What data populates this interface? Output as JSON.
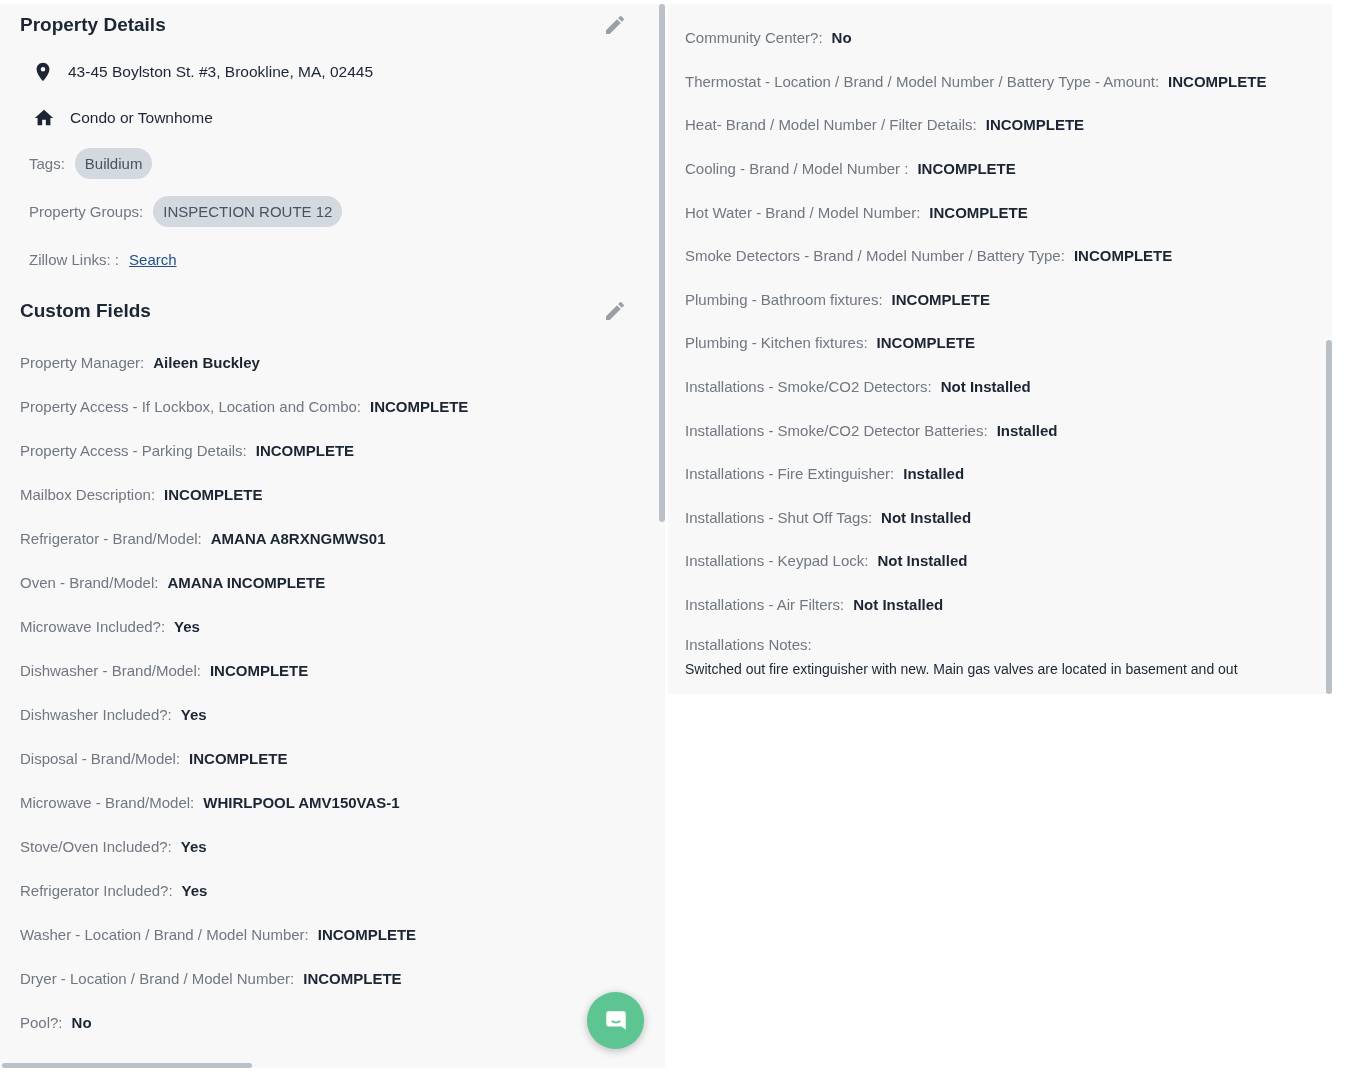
{
  "property_details": {
    "title": "Property Details",
    "address": "43-45 Boylston St. #3, Brookline, MA, 02445",
    "property_type": "Condo or Townhome",
    "tags": {
      "label": "Tags:",
      "items": [
        "Buildium"
      ]
    },
    "property_groups": {
      "label": "Property Groups:",
      "items": [
        "INSPECTION ROUTE 12"
      ]
    },
    "zillow_links": {
      "label": "Zillow Links: :",
      "link": "Search"
    }
  },
  "custom_fields": {
    "title": "Custom Fields",
    "fields": [
      {
        "label": "Property Manager:",
        "value": "Aileen Buckley"
      },
      {
        "label": "Property Access - If Lockbox, Location and Combo:",
        "value": "INCOMPLETE"
      },
      {
        "label": "Property Access - Parking Details:",
        "value": "INCOMPLETE"
      },
      {
        "label": "Mailbox Description:",
        "value": "INCOMPLETE"
      },
      {
        "label": "Refrigerator - Brand/Model:",
        "value": "AMANA A8RXNGMWS01"
      },
      {
        "label": "Oven - Brand/Model:",
        "value": "AMANA INCOMPLETE"
      },
      {
        "label": "Microwave Included?:",
        "value": "Yes"
      },
      {
        "label": "Dishwasher - Brand/Model:",
        "value": "INCOMPLETE"
      },
      {
        "label": "Dishwasher Included?:",
        "value": "Yes"
      },
      {
        "label": "Disposal - Brand/Model:",
        "value": "INCOMPLETE"
      },
      {
        "label": "Microwave - Brand/Model:",
        "value": "WHIRLPOOL AMV150VAS-1"
      },
      {
        "label": "Stove/Oven Included?:",
        "value": "Yes"
      },
      {
        "label": "Refrigerator Included?:",
        "value": "Yes"
      },
      {
        "label": "Washer - Location / Brand / Model Number:",
        "value": "INCOMPLETE"
      },
      {
        "label": "Dryer - Location / Brand / Model Number:",
        "value": "INCOMPLETE"
      },
      {
        "label": "Pool?:",
        "value": "No"
      }
    ]
  },
  "more_fields": [
    {
      "kind": "inline",
      "label": "Community Center?:",
      "value": "No"
    },
    {
      "kind": "inline",
      "label": "Thermostat - Location / Brand / Model Number / Battery Type - Amount:",
      "value": "INCOMPLETE"
    },
    {
      "kind": "inline",
      "label": "Heat- Brand / Model Number / Filter Details:",
      "value": "INCOMPLETE"
    },
    {
      "kind": "inline",
      "label": "Cooling - Brand / Model Number :",
      "value": "INCOMPLETE"
    },
    {
      "kind": "inline",
      "label": "Hot Water - Brand / Model Number:",
      "value": "INCOMPLETE"
    },
    {
      "kind": "inline",
      "label": "Smoke Detectors - Brand / Model Number / Battery Type:",
      "value": "INCOMPLETE"
    },
    {
      "kind": "inline",
      "label": "Plumbing - Bathroom fixtures:",
      "value": "INCOMPLETE"
    },
    {
      "kind": "inline",
      "label": "Plumbing - Kitchen fixtures:",
      "value": "INCOMPLETE"
    },
    {
      "kind": "inline",
      "label": "Installations - Smoke/CO2 Detectors:",
      "value": "Not Installed"
    },
    {
      "kind": "inline",
      "label": "Installations - Smoke/CO2 Detector Batteries:",
      "value": "Installed"
    },
    {
      "kind": "inline",
      "label": "Installations - Fire Extinguisher:",
      "value": "Installed"
    },
    {
      "kind": "inline",
      "label": "Installations - Shut Off Tags:",
      "value": "Not Installed"
    },
    {
      "kind": "inline",
      "label": "Installations - Keypad Lock:",
      "value": "Not Installed"
    },
    {
      "kind": "inline",
      "label": "Installations - Air Filters:",
      "value": "Not Installed"
    },
    {
      "kind": "block",
      "label": "Installations Notes:",
      "value": "Switched out fire extinguisher with new. Main gas valves are located in basement and out"
    }
  ]
}
